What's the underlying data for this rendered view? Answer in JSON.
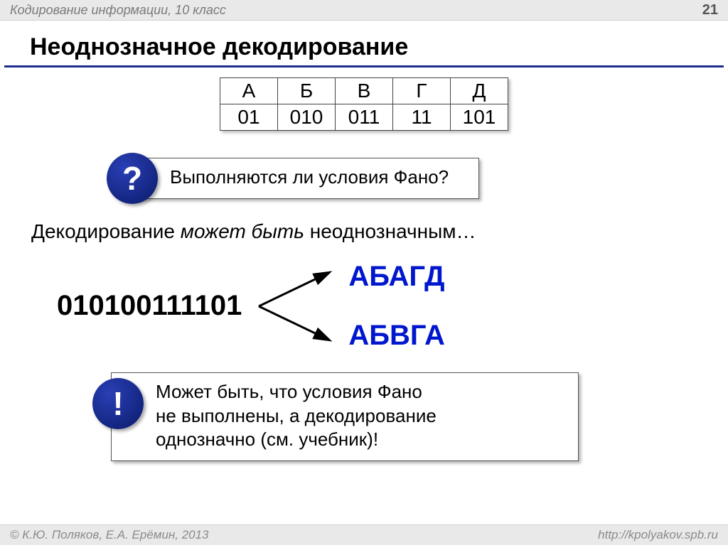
{
  "header": {
    "subject": "Кодирование информации, 10 класс",
    "page": "21"
  },
  "title": "Неоднозначное декодирование",
  "table": {
    "letters": [
      "А",
      "Б",
      "В",
      "Г",
      "Д"
    ],
    "codes": [
      "01",
      "010",
      "011",
      "11",
      "101"
    ]
  },
  "question": {
    "badge": "?",
    "text": "Выполняются ли условия Фано?"
  },
  "statement": {
    "pre": "Декодирование ",
    "italic": "может быть",
    "post": " неоднозначным…"
  },
  "decoding": {
    "bitstring": "010100111101",
    "result1": "АБАГД",
    "result2": "АБВГА"
  },
  "note": {
    "badge": "!",
    "line1": "Может быть, что условия Фано",
    "line2": "не выполнены, а декодирование",
    "line3": "однозначно (см. учебник)!"
  },
  "footer": {
    "copyright": "© К.Ю. Поляков, Е.А. Ерёмин, 2013",
    "url": "http://kpolyakov.spb.ru"
  }
}
